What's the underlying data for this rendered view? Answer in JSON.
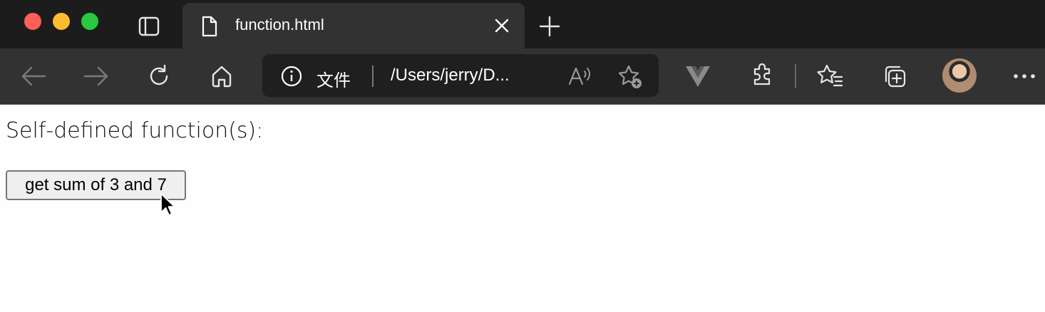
{
  "window": {
    "traffic_lights": [
      "close",
      "minimize",
      "zoom"
    ],
    "colors": {
      "close": "#fe5f57",
      "minimize": "#febc2e",
      "zoom": "#28c840"
    }
  },
  "tab": {
    "title": "function.html",
    "icon": "document-icon"
  },
  "address_bar": {
    "protocol_label": "文件",
    "url": "/Users/jerry/D..."
  },
  "toolbar": {
    "icons": [
      "back-icon",
      "forward-icon",
      "refresh-icon",
      "home-icon",
      "read-aloud-icon",
      "add-favorite-icon",
      "vue-devtools-icon",
      "extensions-icon",
      "favorites-icon",
      "collections-icon",
      "profile-avatar",
      "more-icon"
    ]
  },
  "page": {
    "heading": "Self-defined function(s):",
    "button_label": "get sum of 3 and 7"
  }
}
